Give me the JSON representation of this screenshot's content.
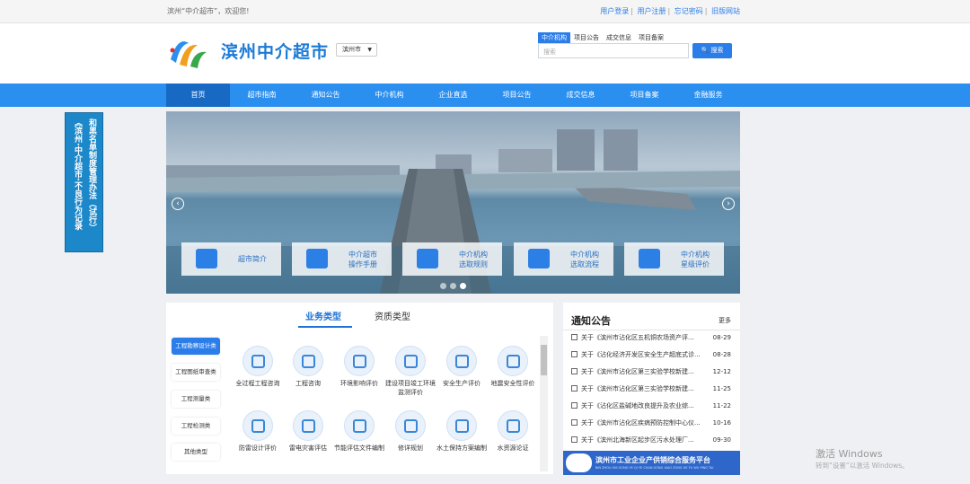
{
  "topbar": {
    "welcome": "滨州“中介超市”，欢迎您!",
    "links": [
      "用户登录",
      "用户注册",
      "忘记密码",
      "旧版网站"
    ]
  },
  "header": {
    "brand": "滨州中介超市",
    "city": "滨州市",
    "search_tabs": [
      "中介机构",
      "项目公告",
      "成交信息",
      "项目备案"
    ],
    "search_placeholder": "搜索",
    "search_button": "搜索"
  },
  "nav": [
    "首页",
    "超市指南",
    "通知公告",
    "中介机构",
    "企业直选",
    "项目公告",
    "成交信息",
    "项目备案",
    "金融服务"
  ],
  "side_banner": {
    "columns": [
      "和黑名单制度管理办法（试行）",
      "《滨州·中介超市·不良行为记录"
    ]
  },
  "carousel": {
    "cards": [
      {
        "label": "超市简介"
      },
      {
        "label": "中介超市\n操作手册"
      },
      {
        "label": "中介机构\n选取规则"
      },
      {
        "label": "中介机构\n选取流程"
      },
      {
        "label": "中介机构\n星级评价"
      }
    ]
  },
  "business": {
    "tabs": [
      "业务类型",
      "资质类型"
    ],
    "categories": [
      "工程勘察设计类",
      "工程图纸审查类",
      "工程测量类",
      "工程检测类",
      "其他类型"
    ],
    "services": [
      "全过程工程咨询",
      "工程咨询",
      "环境影响评价",
      "建设项目竣工环境监测评价",
      "安全生产评价",
      "地震安全性评价",
      "防雷设计评价",
      "雷电灾害评估",
      "节能评估文件编制",
      "修详规划",
      "水土保持方案编制",
      "水资源论证"
    ]
  },
  "notice": {
    "title": "通知公告",
    "more": "更多",
    "items": [
      {
        "text": "关于《滨州市沾化区五机铜农场资产评...",
        "date": "08-29"
      },
      {
        "text": "关于《沾化经济开发区安全生产超底式诊...",
        "date": "08-28"
      },
      {
        "text": "关于《滨州市沾化区第三实验学校新建...",
        "date": "12-12"
      },
      {
        "text": "关于《滨州市沾化区第三实验学校新建...",
        "date": "11-25"
      },
      {
        "text": "关于《沾化区盐碱地改良提升及农业综...",
        "date": "11-22"
      },
      {
        "text": "关于《滨州市沾化区疾病预防控制中心仪...",
        "date": "10-16"
      },
      {
        "text": "关于《滨州北海新区起步区污水处理厂...",
        "date": "09-30"
      }
    ]
  },
  "platform": {
    "title": "滨州市工业企业产供销综合服务平台",
    "subtitle": "BIN ZHOU SHI GONG YE QI YE CHAN GONG XIAO ZONG HE FU WU PING TAI"
  },
  "watermark": {
    "line1": "激活 Windows",
    "line2": "转到“设置”以激活 Windows。"
  }
}
